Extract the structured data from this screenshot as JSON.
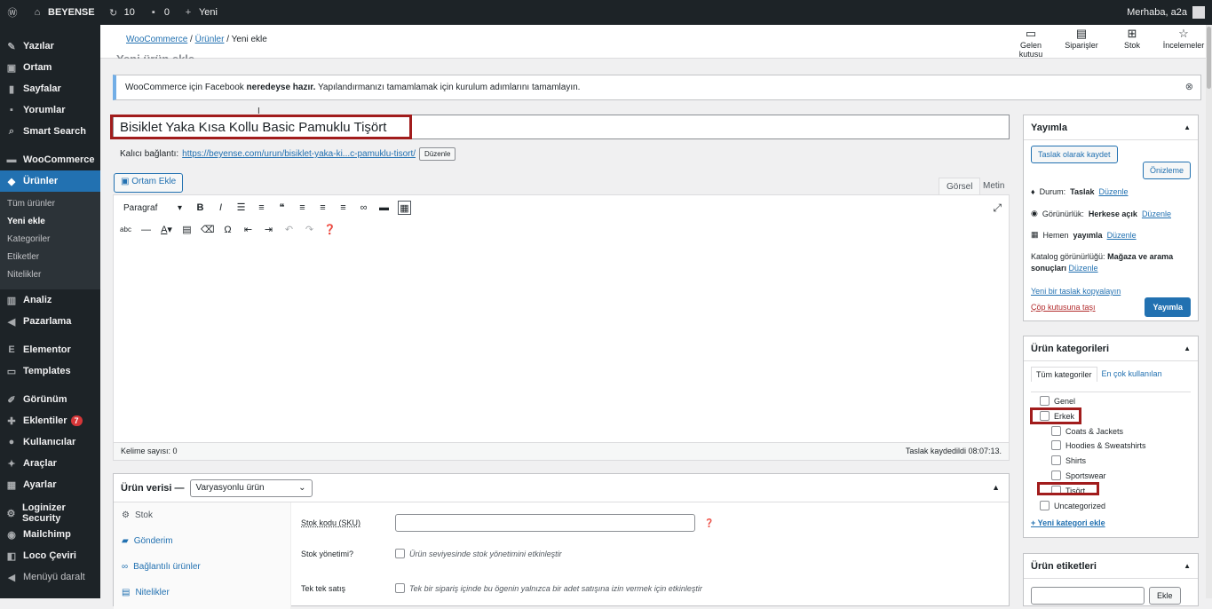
{
  "adminbar": {
    "site": "BEYENSE",
    "updates": "10",
    "comments": "0",
    "new": "Yeni",
    "greeting": "Merhaba, a2a"
  },
  "sidebar": {
    "items": [
      "Yazılar",
      "Ortam",
      "Sayfalar",
      "Yorumlar",
      "Smart Search",
      "WooCommerce",
      "Ürünler"
    ],
    "sub": [
      "Tüm ürünler",
      "Yeni ekle",
      "Kategoriler",
      "Etiketler",
      "Nitelikler"
    ],
    "items2": [
      "Analiz",
      "Pazarlama",
      "Elementor",
      "Templates",
      "Görünüm",
      "Eklentiler",
      "Kullanıcılar",
      "Araçlar",
      "Ayarlar",
      "Loginizer Security",
      "Mailchimp",
      "Loco Çeviri",
      "Menüyü daralt"
    ],
    "plugins_badge": "7"
  },
  "topbar": {
    "breadcrumb": {
      "a": "WooCommerce",
      "b": "Ürünler",
      "c": "Yeni ekle"
    },
    "buttons": {
      "inbox1": "Gelen",
      "inbox2": "kutusu",
      "orders": "Siparişler",
      "stock": "Stok",
      "reviews": "İncelemeler"
    }
  },
  "page": {
    "ghost_title": "Yeni ürün ekle"
  },
  "notice": {
    "pre": "WooCommerce için Facebook ",
    "bold": "neredeyse hazır.",
    "post": " Yapılandırmanızı tamamlamak için kurulum adımlarını tamamlayın."
  },
  "title": {
    "value": "Bisiklet Yaka Kısa Kollu Basic Pamuklu Tişört"
  },
  "permalink": {
    "label": "Kalıcı bağlantı:",
    "url": "https://beyense.com/urun/bisiklet-yaka-ki...c-pamuklu-tisort/",
    "edit": "Düzenle"
  },
  "editor": {
    "media": "Ortam Ekle",
    "tab_visual": "Görsel",
    "tab_text": "Metin",
    "format": "Paragraf",
    "word_count": "Kelime sayısı: 0",
    "saved": "Taslak kaydedildi 08:07:13."
  },
  "product": {
    "label": "Ürün verisi —",
    "type": "Varyasyonlu ürün",
    "tabs": [
      "Stok",
      "Gönderim",
      "Bağlantılı ürünler",
      "Nitelikler"
    ],
    "sku_label": "Stok kodu (SKU)",
    "stock_mgmt": "Stok yönetimi?",
    "stock_mgmt_desc": "Ürün seviyesinde stok yönetimini etkinleştir",
    "sold_ind": "Tek tek satış",
    "sold_ind_desc": "Tek bir sipariş içinde bu ögenin yalnızca bir adet satışına izin vermek için etkinleştir"
  },
  "publish": {
    "title": "Yayımla",
    "save_draft": "Taslak olarak kaydet",
    "preview": "Önizleme",
    "status": "Durum:",
    "status_val": "Taslak",
    "edit": "Düzenle",
    "visibility": "Görünürlük:",
    "visibility_val": "Herkese açık",
    "publish_now": "Hemen",
    "publish_now_b": "yayımla",
    "catalog": "Katalog görünürlüğü:",
    "catalog_val": "Mağaza ve arama sonuçları",
    "copy": "Yeni bir taslak kopyalayın",
    "trash": "Çöp kutusuna taşı",
    "publish": "Yayımla"
  },
  "cats": {
    "title": "Ürün kategorileri",
    "tab_all": "Tüm kategoriler",
    "tab_popular": "En çok kullanılan",
    "list": [
      "Genel",
      "Erkek",
      "Coats & Jackets",
      "Hoodies & Sweatshirts",
      "Shirts",
      "Sportswear",
      "Tişört",
      "Uncategorized"
    ],
    "add": "+ Yeni kategori ekle"
  },
  "tags": {
    "title": "Ürün etiketleri",
    "add": "Ekle"
  }
}
